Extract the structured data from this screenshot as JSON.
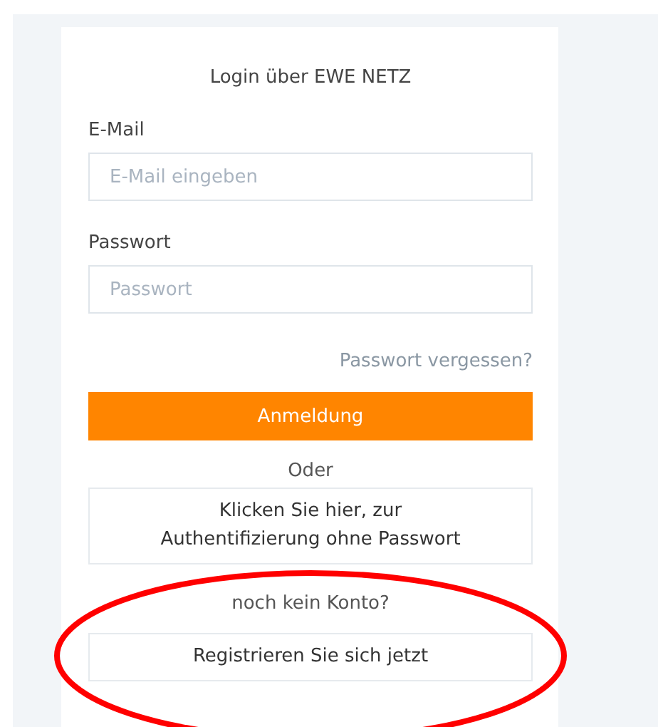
{
  "title": "Login über EWE NETZ",
  "fields": [
    {
      "label": "E-Mail",
      "placeholder": "E-Mail eingeben"
    },
    {
      "label": "Passwort",
      "placeholder": "Passwort"
    }
  ],
  "forgot_link": "Passwort vergessen?",
  "login_button": "Anmeldung",
  "separator": "Oder",
  "passwordless_button": "Klicken Sie hier, zur Authentifizierung ohne Passwort",
  "no_account": "noch kein Konto?",
  "register_button": "Registrieren Sie sich jetzt"
}
